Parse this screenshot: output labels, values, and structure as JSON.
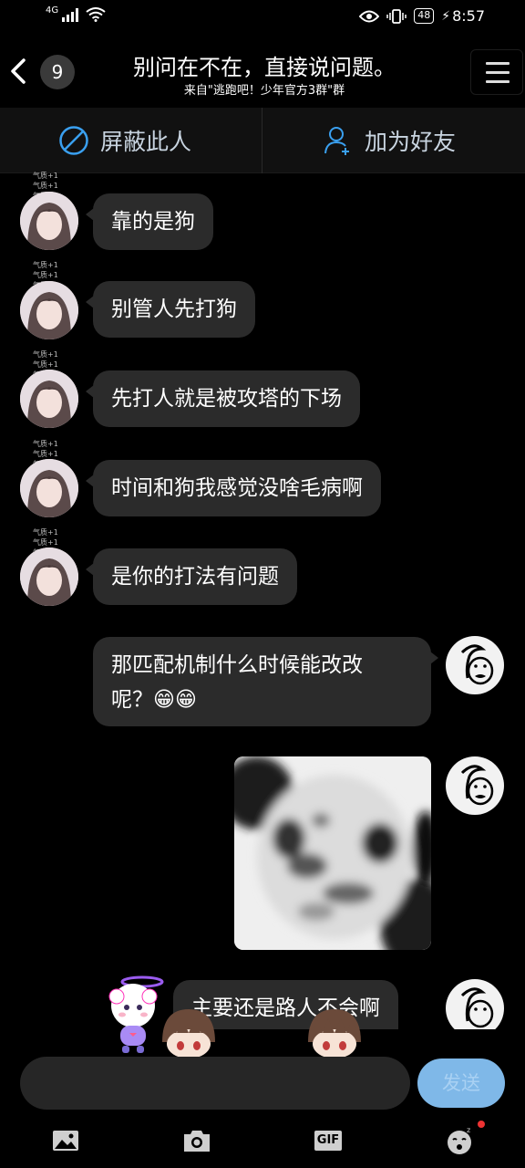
{
  "status_bar": {
    "network": "4G",
    "battery": "48",
    "time": "8:57"
  },
  "header": {
    "back_icon": "chevron-left-icon",
    "unread_count": "9",
    "title": "别问在不在，直接说问题。",
    "subtitle": "来自\"逃跑吧！少年官方3群\"群",
    "menu_icon": "hamburger-icon"
  },
  "action_bar": {
    "block_label": "屏蔽此人",
    "add_friend_label": "加为好友"
  },
  "messages": [
    {
      "side": "in",
      "text": "靠的是狗",
      "tag": "气质+1"
    },
    {
      "side": "in",
      "text": "别管人先打狗",
      "tag": "气质+1"
    },
    {
      "side": "in",
      "text": "先打人就是被攻塔的下场",
      "tag": "气质+1"
    },
    {
      "side": "in",
      "text": "时间和狗我感觉没啥毛病啊",
      "tag": "气质+1"
    },
    {
      "side": "in",
      "text": "是你的打法有问题",
      "tag": "气质+1"
    },
    {
      "side": "out",
      "text_line1": "那匹配机制什么时候能改改",
      "text_line2": "呢？😁😁"
    },
    {
      "side": "out",
      "type": "image",
      "content": "panda-meme-sticker"
    },
    {
      "side": "out",
      "text": "主要还是路人不会啊"
    }
  ],
  "input": {
    "placeholder": "",
    "send_label": "发送"
  },
  "toolbar": {
    "items": [
      "image-icon",
      "camera-icon",
      "gif-icon",
      "emoji-icon"
    ],
    "gif_label": "GIF"
  },
  "colors": {
    "background": "#000000",
    "bubble": "#2b2b2b",
    "send_button": "#7fb8e8",
    "action_icon": "#3aa0f0"
  }
}
